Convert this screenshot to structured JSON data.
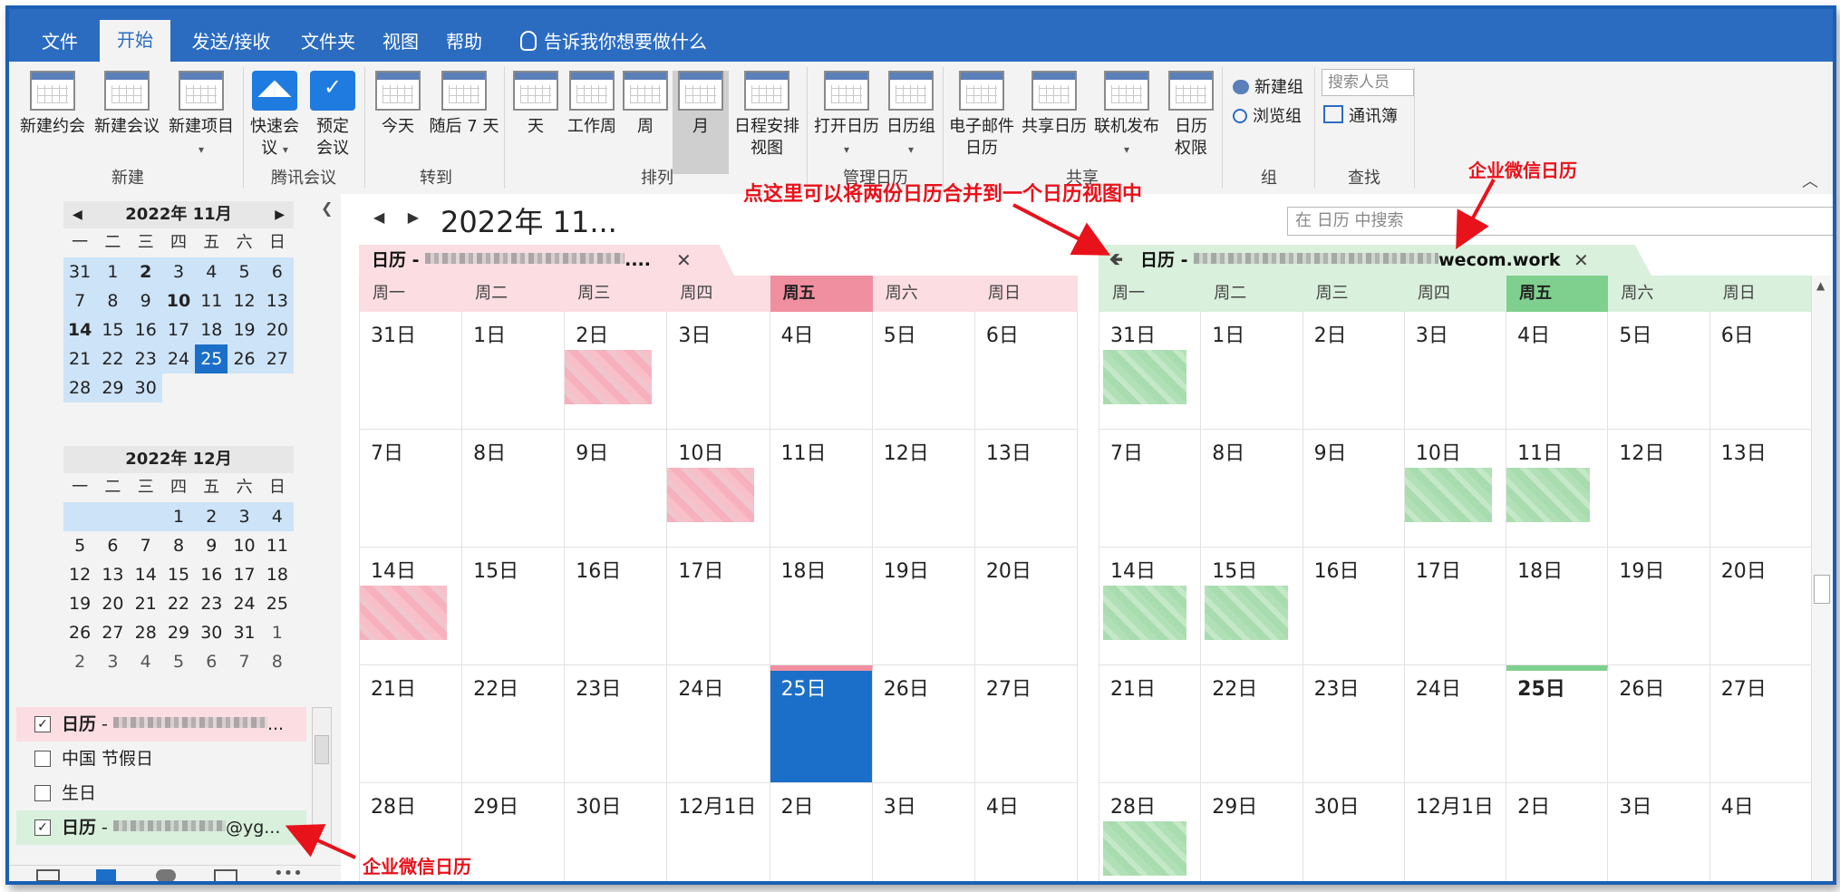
{
  "ribbon": {
    "tabs": [
      "文件",
      "开始",
      "发送/接收",
      "文件夹",
      "视图",
      "帮助"
    ],
    "tellme": "告诉我你想要做什么",
    "buttons": {
      "new_appt": "新建约会",
      "new_meeting": "新建会议",
      "new_item": "新建项目",
      "quick_meeting_1": "快速会",
      "quick_meeting_2": "议",
      "book_meeting_1": "预定",
      "book_meeting_2": "会议",
      "today": "今天",
      "next7": "随后 7 天",
      "day": "天",
      "workweek": "工作周",
      "week": "周",
      "month": "月",
      "schedule_1": "日程安排",
      "schedule_2": "视图",
      "open_cal": "打开日历",
      "cal_group": "日历组",
      "email_cal_1": "电子邮件",
      "email_cal_2": "日历",
      "share_cal": "共享日历",
      "publish": "联机发布",
      "perm_1": "日历",
      "perm_2": "权限",
      "new_group": "新建组",
      "browse_group": "浏览组",
      "search_people": "搜索人员",
      "address_book": "通讯簿"
    },
    "groups": {
      "new": "新建",
      "tencent": "腾讯会议",
      "goto": "转到",
      "arrange": "排列",
      "manage": "管理日历",
      "share": "共享",
      "group": "组",
      "find": "查找"
    }
  },
  "nav": {
    "nov": {
      "title": "2022年 11月",
      "dow": [
        "一",
        "二",
        "三",
        "四",
        "五",
        "六",
        "日"
      ],
      "weeks": [
        [
          "31",
          "1",
          "2",
          "3",
          "4",
          "5",
          "6"
        ],
        [
          "7",
          "8",
          "9",
          "10",
          "11",
          "12",
          "13"
        ],
        [
          "14",
          "15",
          "16",
          "17",
          "18",
          "19",
          "20"
        ],
        [
          "21",
          "22",
          "23",
          "24",
          "25",
          "26",
          "27"
        ],
        [
          "28",
          "29",
          "30",
          "",
          "",
          "",
          ""
        ]
      ]
    },
    "dec": {
      "title": "2022年 12月",
      "dow": [
        "一",
        "二",
        "三",
        "四",
        "五",
        "六",
        "日"
      ],
      "weeks": [
        [
          "",
          "",
          "",
          "1",
          "2",
          "3",
          "4"
        ],
        [
          "5",
          "6",
          "7",
          "8",
          "9",
          "10",
          "11"
        ],
        [
          "12",
          "13",
          "14",
          "15",
          "16",
          "17",
          "18"
        ],
        [
          "19",
          "20",
          "21",
          "22",
          "23",
          "24",
          "25"
        ],
        [
          "26",
          "27",
          "28",
          "29",
          "30",
          "31",
          "1"
        ],
        [
          "2",
          "3",
          "4",
          "5",
          "6",
          "7",
          "8"
        ]
      ]
    },
    "calendars": [
      {
        "label": "日历",
        "suffix": " - ",
        "checked": true,
        "tail": "..."
      },
      {
        "label": "中国 节假日",
        "checked": false
      },
      {
        "label": "生日",
        "checked": false
      },
      {
        "label": "日历",
        "suffix": " - ",
        "checked": true,
        "tail": "@yg..."
      }
    ]
  },
  "main": {
    "title": "2022年 11...",
    "search_placeholder": "在 日历 中搜索",
    "tab_left": {
      "label": "日历 - ",
      "tail": "...."
    },
    "tab_right": {
      "label": "日历 - ",
      "tail": "wecom.work"
    },
    "dow": [
      "周一",
      "周二",
      "周三",
      "周四",
      "周五",
      "周六",
      "周日"
    ],
    "weeks": [
      [
        "31日",
        "1日",
        "2日",
        "3日",
        "4日",
        "5日",
        "6日"
      ],
      [
        "7日",
        "8日",
        "9日",
        "10日",
        "11日",
        "12日",
        "13日"
      ],
      [
        "14日",
        "15日",
        "16日",
        "17日",
        "18日",
        "19日",
        "20日"
      ],
      [
        "21日",
        "22日",
        "23日",
        "24日",
        "25日",
        "26日",
        "27日"
      ],
      [
        "28日",
        "29日",
        "30日",
        "12月1日",
        "2日",
        "3日",
        "4日"
      ]
    ]
  },
  "annotations": {
    "merge_hint": "点这里可以将两份日历合并到一个日历视图中",
    "wecom_top": "企业微信日历",
    "wecom_bottom": "企业微信日历"
  },
  "colors": {
    "ribbon_blue": "#2b6cc1",
    "left_calendar": "#fbdde2",
    "right_calendar": "#d9f0dc",
    "today_fill": "#1b6fc8",
    "annotation_red": "#e8121b"
  }
}
